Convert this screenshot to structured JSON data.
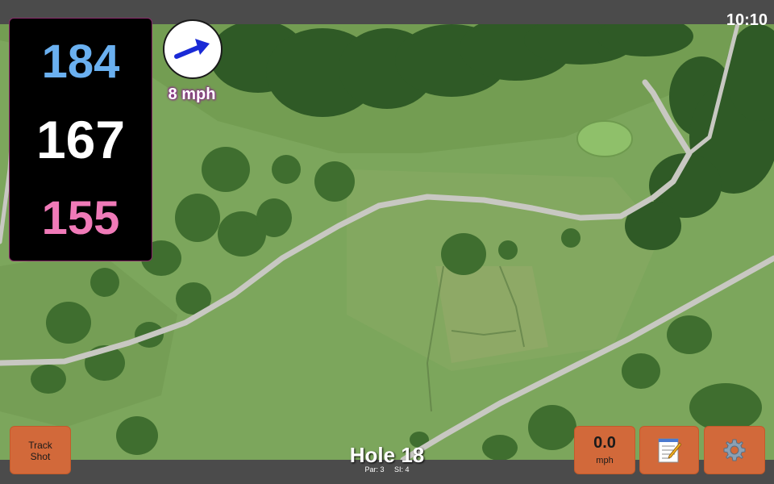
{
  "status": {
    "time": "10:10"
  },
  "distances": {
    "back": "184",
    "middle": "167",
    "front": "155"
  },
  "wind": {
    "speed": "8 mph",
    "direction_icon": "arrow-right-icon"
  },
  "hole": {
    "title": "Hole 18",
    "par": "Par: 3",
    "stroke_index": "SI: 4"
  },
  "buttons": {
    "track_shot_line1": "Track",
    "track_shot_line2": "Shot",
    "speed_value": "0.0",
    "speed_unit": "mph",
    "notes_icon": "notepad-icon",
    "settings_icon": "gear-icon"
  },
  "colors": {
    "back": "#6ab0f0",
    "middle": "#ffffff",
    "front": "#f07ab8",
    "button": "#d2693a",
    "wind_arrow": "#1a2ad6"
  }
}
